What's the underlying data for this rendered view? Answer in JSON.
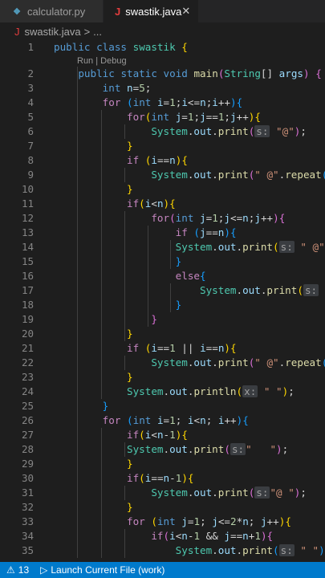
{
  "tabs": [
    {
      "label": "calculator.py",
      "icon": "python-file-icon"
    },
    {
      "label": "swastik.java",
      "icon": "java-file-icon",
      "active": true
    }
  ],
  "breadcrumb": {
    "file": "swastik.java",
    "separator": ">",
    "more": "..."
  },
  "codelens": "Run | Debug",
  "lines": [
    {
      "n": "1"
    },
    {
      "n": "2"
    },
    {
      "n": "3"
    },
    {
      "n": "4"
    },
    {
      "n": "5"
    },
    {
      "n": "6"
    },
    {
      "n": "7"
    },
    {
      "n": "8"
    },
    {
      "n": "9"
    },
    {
      "n": "10"
    },
    {
      "n": "11"
    },
    {
      "n": "12"
    },
    {
      "n": "13"
    },
    {
      "n": "14"
    },
    {
      "n": "15"
    },
    {
      "n": "16"
    },
    {
      "n": "17"
    },
    {
      "n": "18"
    },
    {
      "n": "19"
    },
    {
      "n": "20"
    },
    {
      "n": "21"
    },
    {
      "n": "22"
    },
    {
      "n": "23"
    },
    {
      "n": "24"
    },
    {
      "n": "25"
    },
    {
      "n": "26"
    },
    {
      "n": "27"
    },
    {
      "n": "28"
    },
    {
      "n": "29"
    },
    {
      "n": "30"
    },
    {
      "n": "31"
    },
    {
      "n": "32"
    },
    {
      "n": "33"
    },
    {
      "n": "34"
    },
    {
      "n": "35"
    }
  ],
  "code": {
    "l1": [
      [
        "k",
        "public"
      ],
      [
        "o",
        " "
      ],
      [
        "k",
        "class"
      ],
      [
        "o",
        " "
      ],
      [
        "t",
        "swastik"
      ],
      [
        "o",
        " "
      ],
      [
        "b1",
        "{"
      ]
    ],
    "l2": [
      [
        "o",
        "    "
      ],
      [
        "k",
        "public"
      ],
      [
        "o",
        " "
      ],
      [
        "k",
        "static"
      ],
      [
        "o",
        " "
      ],
      [
        "k",
        "void"
      ],
      [
        "o",
        " "
      ],
      [
        "f",
        "main"
      ],
      [
        "b2",
        "("
      ],
      [
        "t",
        "String"
      ],
      [
        "o",
        "[] "
      ],
      [
        "v",
        "args"
      ],
      [
        "b2",
        ")"
      ],
      [
        "o",
        " "
      ],
      [
        "b2",
        "{"
      ]
    ],
    "l3": [
      [
        "o",
        "        "
      ],
      [
        "k",
        "int"
      ],
      [
        "o",
        " "
      ],
      [
        "v",
        "n"
      ],
      [
        "o",
        "="
      ],
      [
        "n",
        "5"
      ],
      [
        "o",
        ";"
      ]
    ],
    "l4": [
      [
        "o",
        "        "
      ],
      [
        "c",
        "for"
      ],
      [
        "o",
        " "
      ],
      [
        "b3",
        "("
      ],
      [
        "k",
        "int"
      ],
      [
        "o",
        " "
      ],
      [
        "v",
        "i"
      ],
      [
        "o",
        "="
      ],
      [
        "n",
        "1"
      ],
      [
        "o",
        ";"
      ],
      [
        "v",
        "i"
      ],
      [
        "o",
        "<="
      ],
      [
        "v",
        "n"
      ],
      [
        "o",
        ";"
      ],
      [
        "v",
        "i"
      ],
      [
        "o",
        "++"
      ],
      [
        "b3",
        ")"
      ],
      [
        "b3",
        "{"
      ]
    ],
    "l5": [
      [
        "o",
        "            "
      ],
      [
        "c",
        "for"
      ],
      [
        "b1",
        "("
      ],
      [
        "k",
        "int"
      ],
      [
        "o",
        " "
      ],
      [
        "v",
        "j"
      ],
      [
        "o",
        "="
      ],
      [
        "n",
        "1"
      ],
      [
        "o",
        ";"
      ],
      [
        "v",
        "j"
      ],
      [
        "o",
        "=="
      ],
      [
        "n",
        "1"
      ],
      [
        "o",
        ";"
      ],
      [
        "v",
        "j"
      ],
      [
        "o",
        "++"
      ],
      [
        "b1",
        ")"
      ],
      [
        "b1",
        "{"
      ]
    ],
    "l6": [
      [
        "o",
        "                "
      ],
      [
        "t",
        "System"
      ],
      [
        "o",
        "."
      ],
      [
        "v",
        "out"
      ],
      [
        "o",
        "."
      ],
      [
        "f",
        "print"
      ],
      [
        "b2",
        "("
      ],
      [
        "hint",
        "s:"
      ],
      [
        "o",
        " "
      ],
      [
        "s",
        "\"@\""
      ],
      [
        "b2",
        ")"
      ],
      [
        "o",
        ";"
      ]
    ],
    "l7": [
      [
        "o",
        "            "
      ],
      [
        "b1",
        "}"
      ]
    ],
    "l8": [
      [
        "o",
        "            "
      ],
      [
        "c",
        "if"
      ],
      [
        "o",
        " "
      ],
      [
        "b1",
        "("
      ],
      [
        "v",
        "i"
      ],
      [
        "o",
        "=="
      ],
      [
        "v",
        "n"
      ],
      [
        "b1",
        ")"
      ],
      [
        "b1",
        "{"
      ]
    ],
    "l9": [
      [
        "o",
        "                "
      ],
      [
        "t",
        "System"
      ],
      [
        "o",
        "."
      ],
      [
        "v",
        "out"
      ],
      [
        "o",
        "."
      ],
      [
        "f",
        "print"
      ],
      [
        "b2",
        "("
      ],
      [
        "s",
        "\" @\""
      ],
      [
        "o",
        "."
      ],
      [
        "f",
        "repeat"
      ],
      [
        "b3",
        "("
      ],
      [
        "v",
        "n"
      ],
      [
        "b3",
        ")"
      ],
      [
        "b2",
        ")"
      ]
    ],
    "l10": [
      [
        "o",
        "            "
      ],
      [
        "b1",
        "}"
      ]
    ],
    "l11": [
      [
        "o",
        "            "
      ],
      [
        "c",
        "if"
      ],
      [
        "b1",
        "("
      ],
      [
        "v",
        "i"
      ],
      [
        "o",
        "<"
      ],
      [
        "v",
        "n"
      ],
      [
        "b1",
        ")"
      ],
      [
        "b1",
        "{"
      ]
    ],
    "l12": [
      [
        "o",
        "                "
      ],
      [
        "c",
        "for"
      ],
      [
        "b2",
        "("
      ],
      [
        "k",
        "int"
      ],
      [
        "o",
        " "
      ],
      [
        "v",
        "j"
      ],
      [
        "o",
        "="
      ],
      [
        "n",
        "1"
      ],
      [
        "o",
        ";"
      ],
      [
        "v",
        "j"
      ],
      [
        "o",
        "<="
      ],
      [
        "v",
        "n"
      ],
      [
        "o",
        ";"
      ],
      [
        "v",
        "j"
      ],
      [
        "o",
        "++"
      ],
      [
        "b2",
        ")"
      ],
      [
        "b2",
        "{"
      ]
    ],
    "l13": [
      [
        "o",
        "                    "
      ],
      [
        "c",
        "if"
      ],
      [
        "o",
        " "
      ],
      [
        "b3",
        "("
      ],
      [
        "v",
        "j"
      ],
      [
        "o",
        "=="
      ],
      [
        "v",
        "n"
      ],
      [
        "b3",
        ")"
      ],
      [
        "b3",
        "{"
      ]
    ],
    "l14": [
      [
        "o",
        "                    "
      ],
      [
        "t",
        "System"
      ],
      [
        "o",
        "."
      ],
      [
        "v",
        "out"
      ],
      [
        "o",
        "."
      ],
      [
        "f",
        "print"
      ],
      [
        "b1",
        "("
      ],
      [
        "hint",
        "s:"
      ],
      [
        "o",
        " "
      ],
      [
        "s",
        "\" @\""
      ],
      [
        "b1",
        ")"
      ],
      [
        "o",
        ";"
      ]
    ],
    "l15": [
      [
        "o",
        "                    "
      ],
      [
        "b3",
        "}"
      ]
    ],
    "l16": [
      [
        "o",
        "                    "
      ],
      [
        "c",
        "else"
      ],
      [
        "b3",
        "{"
      ]
    ],
    "l17": [
      [
        "o",
        "                        "
      ],
      [
        "t",
        "System"
      ],
      [
        "o",
        "."
      ],
      [
        "v",
        "out"
      ],
      [
        "o",
        "."
      ],
      [
        "f",
        "print"
      ],
      [
        "b1",
        "("
      ],
      [
        "hint",
        "s:"
      ],
      [
        "o",
        " "
      ],
      [
        "s",
        "\""
      ]
    ],
    "l18": [
      [
        "o",
        "                    "
      ],
      [
        "b3",
        "}"
      ]
    ],
    "l19": [
      [
        "o",
        "                "
      ],
      [
        "b2",
        "}"
      ]
    ],
    "l20": [
      [
        "o",
        "            "
      ],
      [
        "b1",
        "}"
      ]
    ],
    "l21": [
      [
        "o",
        "            "
      ],
      [
        "c",
        "if"
      ],
      [
        "o",
        " "
      ],
      [
        "b1",
        "("
      ],
      [
        "v",
        "i"
      ],
      [
        "o",
        "=="
      ],
      [
        "n",
        "1"
      ],
      [
        "o",
        " || "
      ],
      [
        "v",
        "i"
      ],
      [
        "o",
        "=="
      ],
      [
        "v",
        "n"
      ],
      [
        "b1",
        ")"
      ],
      [
        "b1",
        "{"
      ]
    ],
    "l22": [
      [
        "o",
        "                "
      ],
      [
        "t",
        "System"
      ],
      [
        "o",
        "."
      ],
      [
        "v",
        "out"
      ],
      [
        "o",
        "."
      ],
      [
        "f",
        "print"
      ],
      [
        "b2",
        "("
      ],
      [
        "s",
        "\" @\""
      ],
      [
        "o",
        "."
      ],
      [
        "f",
        "repeat"
      ],
      [
        "b3",
        "("
      ],
      [
        "v",
        "n"
      ],
      [
        "b3",
        ")"
      ],
      [
        "b2",
        ")"
      ]
    ],
    "l23": [
      [
        "o",
        "            "
      ],
      [
        "b1",
        "}"
      ]
    ],
    "l24": [
      [
        "o",
        "            "
      ],
      [
        "t",
        "System"
      ],
      [
        "o",
        "."
      ],
      [
        "v",
        "out"
      ],
      [
        "o",
        "."
      ],
      [
        "f",
        "println"
      ],
      [
        "b1",
        "("
      ],
      [
        "hint",
        "x:"
      ],
      [
        "o",
        " "
      ],
      [
        "s",
        "\" \""
      ],
      [
        "b1",
        ")"
      ],
      [
        "o",
        ";"
      ]
    ],
    "l25": [
      [
        "o",
        "        "
      ],
      [
        "b3",
        "}"
      ]
    ],
    "l26": [
      [
        "o",
        "        "
      ],
      [
        "c",
        "for"
      ],
      [
        "o",
        " "
      ],
      [
        "b3",
        "("
      ],
      [
        "k",
        "int"
      ],
      [
        "o",
        " "
      ],
      [
        "v",
        "i"
      ],
      [
        "o",
        "="
      ],
      [
        "n",
        "1"
      ],
      [
        "o",
        "; "
      ],
      [
        "v",
        "i"
      ],
      [
        "o",
        "<"
      ],
      [
        "v",
        "n"
      ],
      [
        "o",
        "; "
      ],
      [
        "v",
        "i"
      ],
      [
        "o",
        "++"
      ],
      [
        "b3",
        ")"
      ],
      [
        "b3",
        "{"
      ]
    ],
    "l27": [
      [
        "o",
        "            "
      ],
      [
        "c",
        "if"
      ],
      [
        "b1",
        "("
      ],
      [
        "v",
        "i"
      ],
      [
        "o",
        "<"
      ],
      [
        "v",
        "n"
      ],
      [
        "o",
        "-"
      ],
      [
        "n",
        "1"
      ],
      [
        "b1",
        ")"
      ],
      [
        "b1",
        "{"
      ]
    ],
    "l28": [
      [
        "o",
        "            "
      ],
      [
        "t",
        "System"
      ],
      [
        "o",
        "."
      ],
      [
        "v",
        "out"
      ],
      [
        "o",
        "."
      ],
      [
        "f",
        "print"
      ],
      [
        "b2",
        "("
      ],
      [
        "hint",
        "s:"
      ],
      [
        "s",
        "\"   \""
      ],
      [
        "b2",
        ")"
      ],
      [
        "o",
        ";"
      ]
    ],
    "l29": [
      [
        "o",
        "            "
      ],
      [
        "b1",
        "}"
      ]
    ],
    "l30": [
      [
        "o",
        "            "
      ],
      [
        "c",
        "if"
      ],
      [
        "b1",
        "("
      ],
      [
        "v",
        "i"
      ],
      [
        "o",
        "=="
      ],
      [
        "v",
        "n"
      ],
      [
        "o",
        "-"
      ],
      [
        "n",
        "1"
      ],
      [
        "b1",
        ")"
      ],
      [
        "b1",
        "{"
      ]
    ],
    "l31": [
      [
        "o",
        "                "
      ],
      [
        "t",
        "System"
      ],
      [
        "o",
        "."
      ],
      [
        "v",
        "out"
      ],
      [
        "o",
        "."
      ],
      [
        "f",
        "print"
      ],
      [
        "b2",
        "("
      ],
      [
        "hint",
        "s:"
      ],
      [
        "s",
        "\"@ \""
      ],
      [
        "b2",
        ")"
      ],
      [
        "o",
        ";"
      ]
    ],
    "l32": [
      [
        "o",
        "            "
      ],
      [
        "b1",
        "}"
      ]
    ],
    "l33": [
      [
        "o",
        "            "
      ],
      [
        "c",
        "for"
      ],
      [
        "o",
        " "
      ],
      [
        "b1",
        "("
      ],
      [
        "k",
        "int"
      ],
      [
        "o",
        " "
      ],
      [
        "v",
        "j"
      ],
      [
        "o",
        "="
      ],
      [
        "n",
        "1"
      ],
      [
        "o",
        "; "
      ],
      [
        "v",
        "j"
      ],
      [
        "o",
        "<="
      ],
      [
        "n",
        "2"
      ],
      [
        "o",
        "*"
      ],
      [
        "v",
        "n"
      ],
      [
        "o",
        "; "
      ],
      [
        "v",
        "j"
      ],
      [
        "o",
        "++"
      ],
      [
        "b1",
        ")"
      ],
      [
        "b1",
        "{"
      ]
    ],
    "l34": [
      [
        "o",
        "                "
      ],
      [
        "c",
        "if"
      ],
      [
        "b2",
        "("
      ],
      [
        "v",
        "i"
      ],
      [
        "o",
        "<"
      ],
      [
        "v",
        "n"
      ],
      [
        "o",
        "-"
      ],
      [
        "n",
        "1"
      ],
      [
        "o",
        " && "
      ],
      [
        "v",
        "j"
      ],
      [
        "o",
        "=="
      ],
      [
        "v",
        "n"
      ],
      [
        "o",
        "+"
      ],
      [
        "n",
        "1"
      ],
      [
        "b2",
        ")"
      ],
      [
        "b2",
        "{"
      ]
    ],
    "l35": [
      [
        "o",
        "                    "
      ],
      [
        "t",
        "System"
      ],
      [
        "o",
        "."
      ],
      [
        "v",
        "out"
      ],
      [
        "o",
        "."
      ],
      [
        "f",
        "print"
      ],
      [
        "b3",
        "("
      ],
      [
        "hint",
        "s:"
      ],
      [
        "o",
        " "
      ],
      [
        "s",
        "\" \""
      ],
      [
        "b3",
        ")"
      ],
      [
        "o",
        ";"
      ]
    ]
  },
  "status": {
    "problems_count": "13",
    "launch_label": "Launch Current File (work)"
  },
  "colors": {
    "status_bar": "#007acc",
    "editor_bg": "#1e1e1e",
    "keyword": "#569cd6",
    "type": "#4ec9b0"
  }
}
